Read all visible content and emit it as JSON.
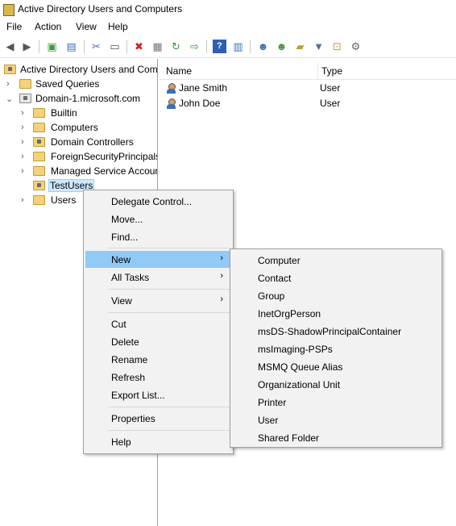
{
  "window": {
    "title": "Active Directory Users and Computers"
  },
  "menubar": [
    "File",
    "Action",
    "View",
    "Help"
  ],
  "toolbar": {
    "icons": [
      "back-arrow-icon",
      "forward-arrow-icon",
      "up-folder-icon",
      "show-hide-tree-icon",
      "cut-icon",
      "copy-icon",
      "delete-icon",
      "properties-icon",
      "refresh-icon",
      "export-list-icon",
      "help-icon",
      "console-pane-icon",
      "add-user-icon",
      "add-group-icon",
      "add-ou-icon",
      "filter-icon",
      "find-icon",
      "delegate-icon"
    ]
  },
  "tree": {
    "root": "Active Directory Users and Com",
    "saved_queries": "Saved Queries",
    "domain": "Domain-1.microsoft.com",
    "children": [
      {
        "label": "Builtin",
        "expander": true
      },
      {
        "label": "Computers",
        "expander": true
      },
      {
        "label": "Domain Controllers",
        "expander": true
      },
      {
        "label": "ForeignSecurityPrincipals",
        "expander": true
      },
      {
        "label": "Managed Service Accour",
        "expander": true
      },
      {
        "label": "TestUsers",
        "expander": false
      },
      {
        "label": "Users",
        "expander": true
      }
    ]
  },
  "list": {
    "columns": [
      "Name",
      "Type"
    ],
    "rows": [
      {
        "name": "Jane Smith",
        "type": "User"
      },
      {
        "name": "John Doe",
        "type": "User"
      }
    ]
  },
  "context_menu": {
    "items": [
      "Delegate Control...",
      "Move...",
      "Find...",
      "New",
      "All Tasks",
      "View",
      "Cut",
      "Delete",
      "Rename",
      "Refresh",
      "Export List...",
      "Properties",
      "Help"
    ]
  },
  "new_submenu": {
    "items": [
      "Computer",
      "Contact",
      "Group",
      "InetOrgPerson",
      "msDS-ShadowPrincipalContainer",
      "msImaging-PSPs",
      "MSMQ Queue Alias",
      "Organizational Unit",
      "Printer",
      "User",
      "Shared Folder"
    ]
  },
  "colors": {
    "selection_bg": "#cce8ff",
    "menu_highlight": "#91c9f7",
    "menu_bg": "#f2f2f2",
    "folder": "#f3d27a"
  }
}
